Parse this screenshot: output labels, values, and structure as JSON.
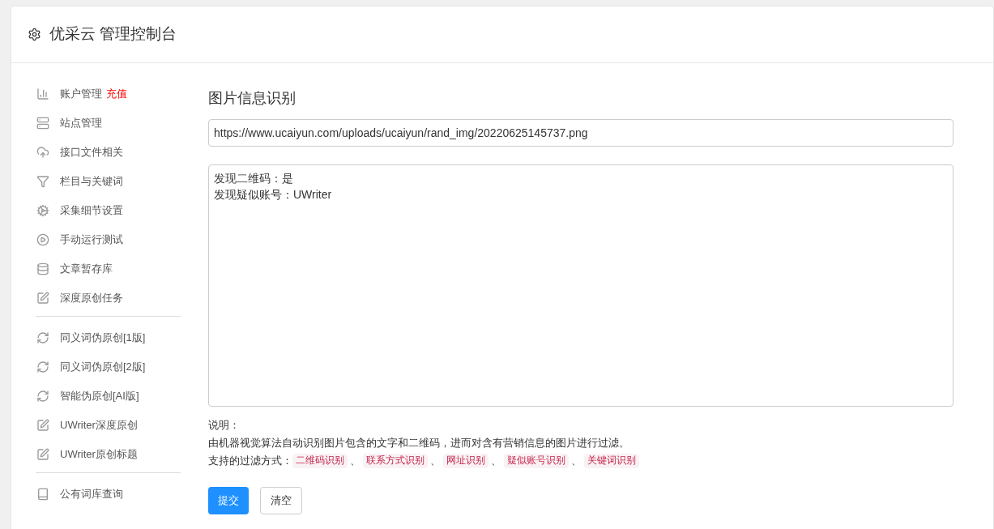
{
  "header": {
    "title": "优采云 管理控制台"
  },
  "sidebar": {
    "groups": [
      {
        "items": [
          {
            "label": "账户管理",
            "badge": "充值"
          },
          {
            "label": "站点管理"
          },
          {
            "label": "接口文件相关"
          },
          {
            "label": "栏目与关键词"
          },
          {
            "label": "采集细节设置"
          },
          {
            "label": "手动运行测试"
          },
          {
            "label": "文章暂存库"
          },
          {
            "label": "深度原创任务"
          }
        ]
      },
      {
        "items": [
          {
            "label": "同义词伪原创[1版]"
          },
          {
            "label": "同义词伪原创[2版]"
          },
          {
            "label": "智能伪原创[AI版]"
          },
          {
            "label": "UWriter深度原创"
          },
          {
            "label": "UWriter原创标题"
          }
        ]
      },
      {
        "items": [
          {
            "label": "公有词库查询"
          }
        ]
      }
    ]
  },
  "main": {
    "heading": "图片信息识别",
    "url_field": {
      "value": "https://www.ucaiyun.com/uploads/ucaiyun/rand_img/20220625145737.png"
    },
    "result_box": {
      "lines": [
        "发现二维码：是",
        "发现疑似账号：UWriter"
      ]
    },
    "notes": {
      "title": "说明：",
      "description": "由机器视觉算法自动识别图片包含的文字和二维码，进而对含有营销信息的图片进行过滤。",
      "filters_label": "支持的过滤方式：",
      "filters": [
        {
          "label": "二维码识别",
          "separator": "、"
        },
        {
          "label": "联系方式识别",
          "separator": "、"
        },
        {
          "label": "网址识别",
          "separator": "、"
        },
        {
          "label": "疑似账号识别",
          "separator": "、"
        },
        {
          "label": "关键词识别"
        }
      ]
    },
    "buttons": [
      {
        "label": "提交",
        "kind": "primary"
      },
      {
        "label": "清空",
        "kind": "default"
      }
    ]
  }
}
